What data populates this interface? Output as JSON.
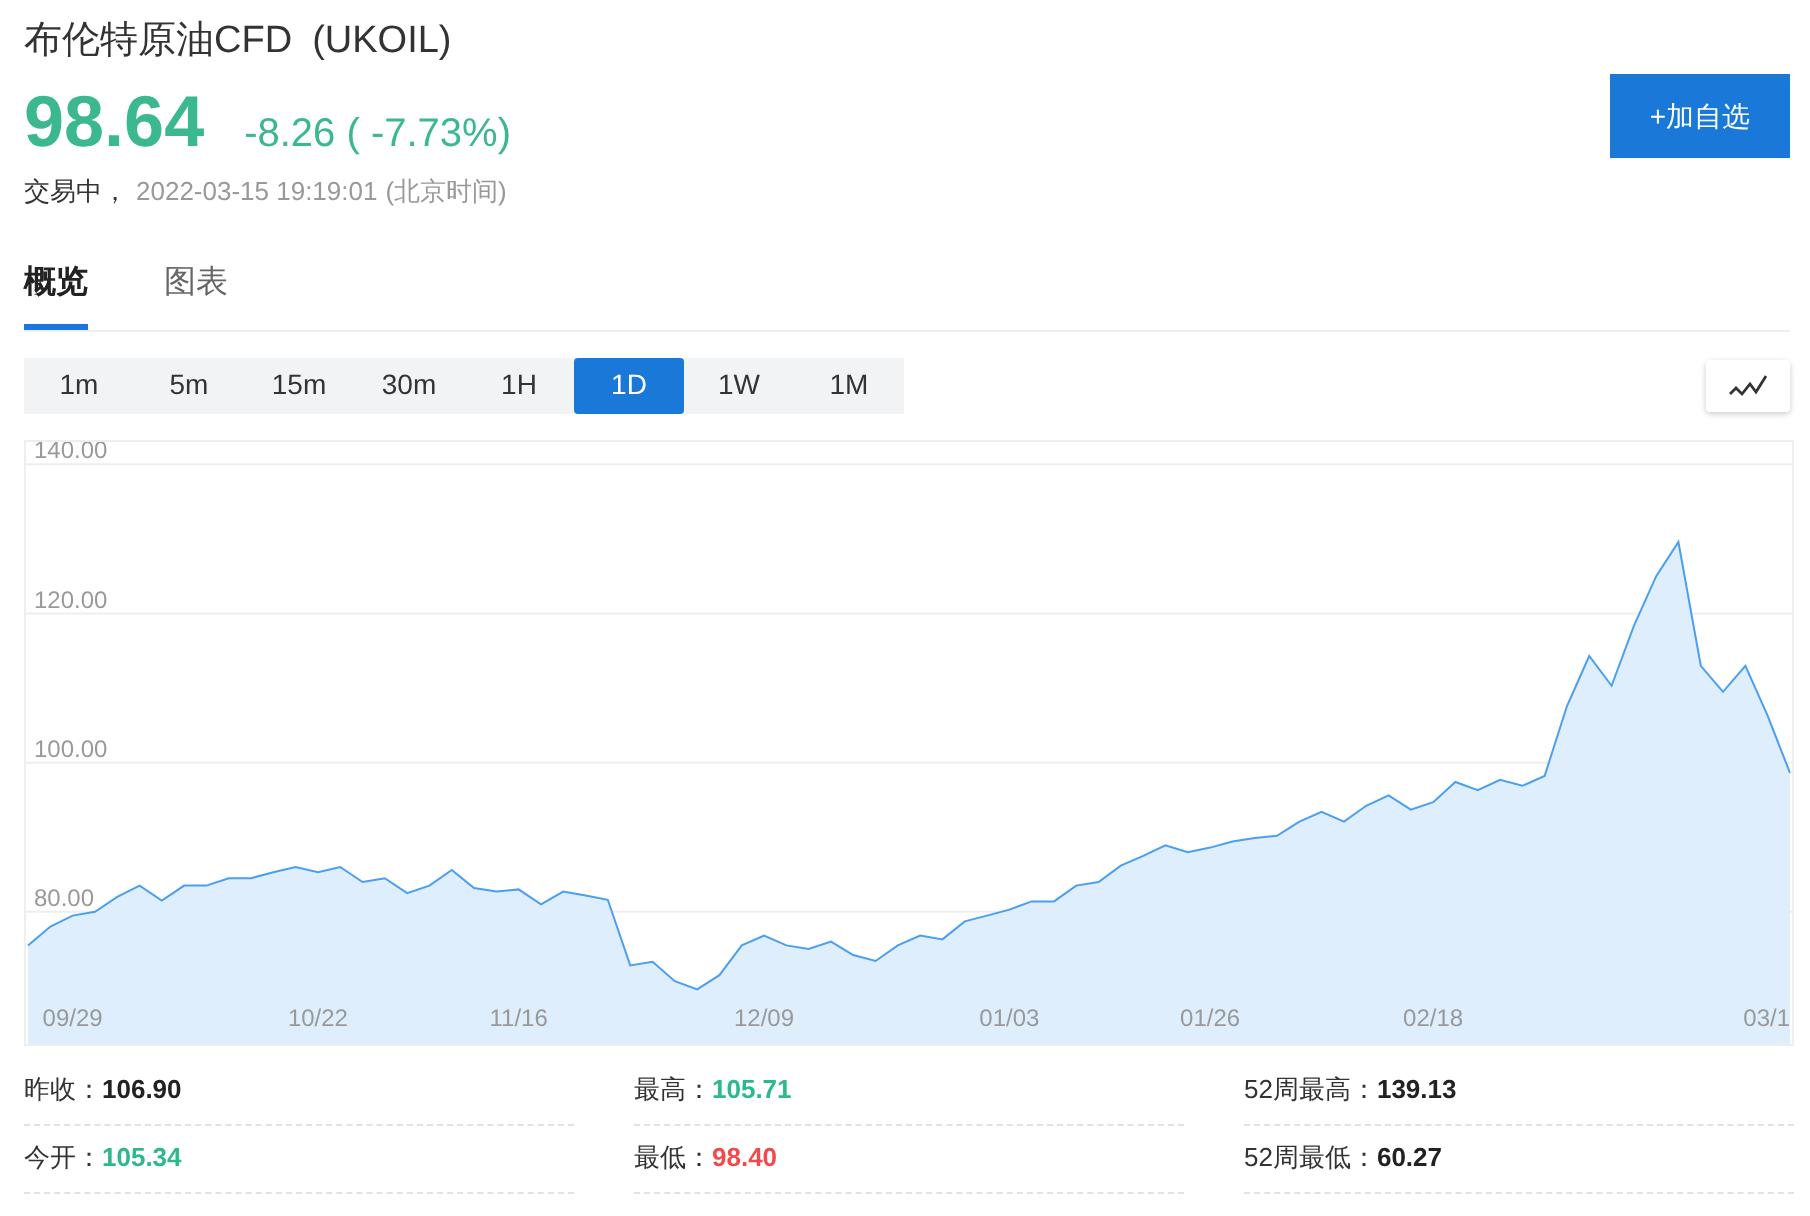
{
  "header": {
    "name": "布伦特原油CFD",
    "symbol": "(UKOIL)",
    "price": "98.64",
    "change": "-8.26 ( -7.73%)",
    "status": "交易中，",
    "timestamp": "2022-03-15 19:19:01",
    "timezone": "(北京时间)",
    "watch_button": "+加自选"
  },
  "tabs": [
    {
      "label": "概览",
      "selected": true
    },
    {
      "label": "图表",
      "selected": false
    }
  ],
  "intervals": [
    {
      "label": "1m",
      "selected": false
    },
    {
      "label": "5m",
      "selected": false
    },
    {
      "label": "15m",
      "selected": false
    },
    {
      "label": "30m",
      "selected": false
    },
    {
      "label": "1H",
      "selected": false
    },
    {
      "label": "1D",
      "selected": true
    },
    {
      "label": "1W",
      "selected": false
    },
    {
      "label": "1M",
      "selected": false
    }
  ],
  "chart_data": {
    "type": "area",
    "grid": true,
    "ylim": [
      62,
      143
    ],
    "yticks": [
      {
        "value": 80,
        "label": "80.00"
      },
      {
        "value": 100,
        "label": "100.00"
      },
      {
        "value": 120,
        "label": "120.00"
      },
      {
        "value": 140,
        "label": "140.00"
      }
    ],
    "categories": [
      null,
      null,
      "09/29",
      null,
      null,
      null,
      null,
      null,
      null,
      null,
      null,
      null,
      null,
      "10/22",
      null,
      null,
      null,
      null,
      null,
      null,
      null,
      null,
      "11/16",
      null,
      null,
      null,
      null,
      null,
      null,
      null,
      null,
      null,
      null,
      "12/09",
      null,
      null,
      null,
      null,
      null,
      null,
      null,
      null,
      null,
      null,
      "01/03",
      null,
      null,
      null,
      null,
      null,
      null,
      null,
      null,
      "01/26",
      null,
      null,
      null,
      null,
      null,
      null,
      null,
      null,
      null,
      "02/18",
      null,
      null,
      null,
      null,
      null,
      null,
      null,
      null,
      null,
      null,
      null,
      null,
      null,
      null,
      "03/1",
      null
    ],
    "series": [
      {
        "color": "#4a9ff0",
        "values": [
          75.5,
          78,
          79.5,
          80,
          82,
          83.5,
          81.5,
          83.5,
          83.5,
          84.5,
          84.5,
          85.3,
          86,
          85.3,
          86,
          84,
          84.5,
          82.5,
          83.5,
          85.6,
          83.2,
          82.7,
          83,
          81,
          82.7,
          82.2,
          81.6,
          72.8,
          73.3,
          70.7,
          69.6,
          71.5,
          75.5,
          76.8,
          75.5,
          75,
          76,
          74.2,
          73.4,
          75.5,
          76.8,
          76.3,
          78.7,
          79.5,
          80.3,
          81.4,
          81.4,
          83.5,
          84,
          86.2,
          87.5,
          88.9,
          88,
          88.6,
          89.4,
          89.9,
          90.2,
          92.1,
          93.4,
          92.1,
          94.2,
          95.6,
          93.7,
          94.7,
          97.4,
          96.3,
          97.7,
          96.9,
          98.2,
          107.6,
          114.3,
          110.3,
          118.3,
          125,
          129.6,
          113,
          109.5,
          113,
          106.3,
          98.6
        ]
      }
    ]
  },
  "stats": [
    {
      "label": "昨收：",
      "value": "106.90",
      "color": "#222222"
    },
    {
      "label": "最高：",
      "value": "105.71",
      "color": "#2fb88e"
    },
    {
      "label": "52周最高：",
      "value": "139.13",
      "color": "#222222"
    },
    {
      "label": "今开：",
      "value": "105.34",
      "color": "#2fb88e"
    },
    {
      "label": "最低：",
      "value": "98.40",
      "color": "#f04b4b"
    },
    {
      "label": "52周最低：",
      "value": "60.27",
      "color": "#222222"
    }
  ]
}
